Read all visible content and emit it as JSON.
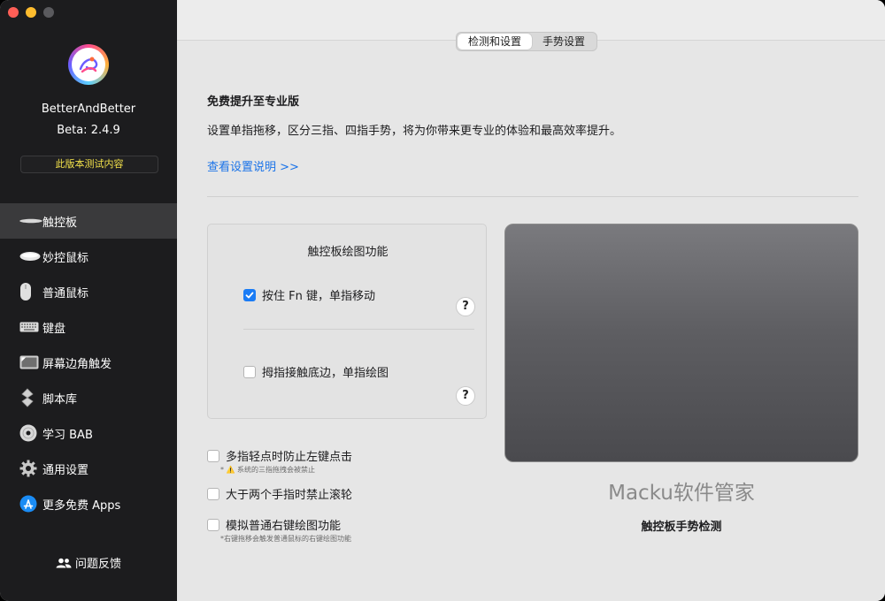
{
  "app": {
    "name": "BetterAndBetter",
    "version": "Beta:  2.4.9",
    "beta_badge": "此版本测试内容"
  },
  "sidebar": {
    "items": [
      {
        "label": "触控板",
        "icon": "trackpad-icon",
        "active": true
      },
      {
        "label": "妙控鼠标",
        "icon": "magic-mouse-icon",
        "active": false
      },
      {
        "label": "普通鼠标",
        "icon": "mouse-icon",
        "active": false
      },
      {
        "label": "键盘",
        "icon": "keyboard-icon",
        "active": false
      },
      {
        "label": "屏幕边角触发",
        "icon": "screen-corner-icon",
        "active": false
      },
      {
        "label": "脚本库",
        "icon": "script-icon",
        "active": false
      },
      {
        "label": "学习 BAB",
        "icon": "dvd-icon",
        "active": false
      },
      {
        "label": "通用设置",
        "icon": "gear-icon",
        "active": false
      },
      {
        "label": "更多免费 Apps",
        "icon": "app-store-icon",
        "active": false
      }
    ],
    "feedback": "问题反馈"
  },
  "tabs": [
    {
      "label": "检测和设置",
      "active": true
    },
    {
      "label": "手势设置",
      "active": false
    }
  ],
  "upgrade": {
    "title": "免费提升至专业版",
    "description": "设置单指拖移，区分三指、四指手势，将为你带来更专业的体验和最高效率提升。",
    "link": "查看设置说明 >>"
  },
  "drawing_panel": {
    "title": "触控板绘图功能",
    "options": [
      {
        "label": "按住 Fn 键，单指移动",
        "checked": true
      },
      {
        "label": "拇指接触底边，单指绘图",
        "checked": false
      }
    ],
    "help": "?"
  },
  "options": [
    {
      "label": "多指轻点时防止左键点击",
      "note": "* ⚠️ 系统的三指拖拽会被禁止",
      "checked": false
    },
    {
      "label": "大于两个手指时禁止滚轮",
      "note": "",
      "checked": false
    },
    {
      "label": "模拟普通右键绘图功能",
      "note": "*右键拖移会触发普通鼠标的右键绘图功能",
      "checked": false
    }
  ],
  "trackpad": {
    "watermark": "Macku软件管家",
    "label": "触控板手势检测"
  },
  "colors": {
    "accent": "#1a7cf5",
    "link": "#1a73e8",
    "sidebar_bg": "#1c1c1e",
    "badge_text": "#f2e14a"
  }
}
